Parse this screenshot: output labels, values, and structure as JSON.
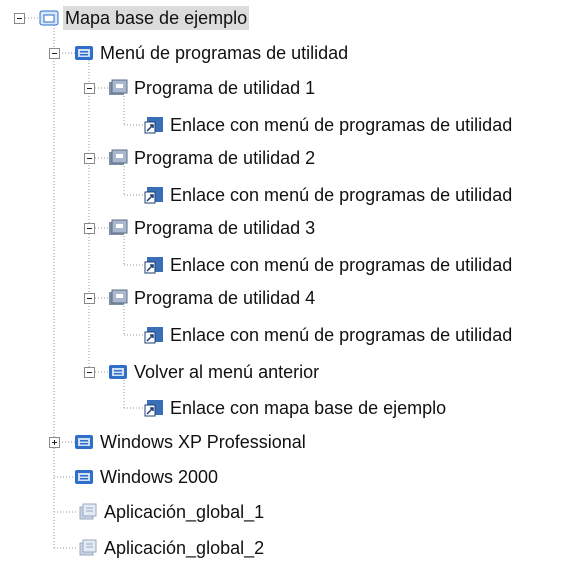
{
  "tree": {
    "root": {
      "label": "Mapa base de ejemplo",
      "icon": "base-map-icon",
      "expanded": true
    },
    "menu_utilidades": {
      "label": "Menú de programas de utilidad",
      "icon": "menu-icon",
      "expanded": true
    },
    "programs": [
      {
        "label": "Programa de utilidad 1",
        "icon": "utility-program-icon",
        "expanded": true,
        "link": "Enlace con menú de programas de utilidad"
      },
      {
        "label": "Programa de utilidad 2",
        "icon": "utility-program-icon",
        "expanded": true,
        "link": "Enlace con menú de programas de utilidad"
      },
      {
        "label": "Programa de utilidad 3",
        "icon": "utility-program-icon",
        "expanded": true,
        "link": "Enlace con menú de programas de utilidad"
      },
      {
        "label": "Programa de utilidad 4",
        "icon": "utility-program-icon",
        "expanded": true,
        "link": "Enlace con menú de programas de utilidad"
      }
    ],
    "volver": {
      "label": "Volver al menú anterior",
      "icon": "menu-icon",
      "expanded": true,
      "link": "Enlace con mapa base de ejemplo"
    },
    "windows_xp": {
      "label": "Windows XP Professional",
      "icon": "menu-icon",
      "expanded": false
    },
    "windows_2000": {
      "label": "Windows 2000",
      "icon": "menu-icon"
    },
    "apps": [
      {
        "label": "Aplicación_global_1",
        "icon": "global-application-icon"
      },
      {
        "label": "Aplicación_global_2",
        "icon": "global-application-icon"
      }
    ]
  },
  "colors": {
    "selection": "#dcdcdc",
    "menu_blue": "#2f6fc9",
    "tree_line": "#9a9a9a"
  }
}
